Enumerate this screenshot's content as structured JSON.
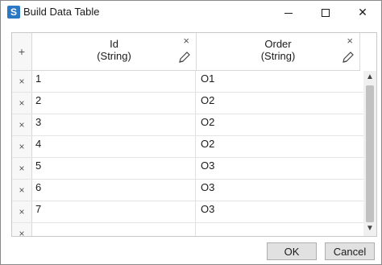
{
  "window": {
    "title": "Build Data Table",
    "app_icon_glyph": "S",
    "controls": {
      "minimize": "",
      "maximize": "",
      "close": "✕"
    }
  },
  "grid": {
    "add_glyph": "+",
    "columns": [
      {
        "name": "Id",
        "type": "(String)",
        "remove_glyph": "×"
      },
      {
        "name": "Order",
        "type": "(String)",
        "remove_glyph": "×"
      }
    ],
    "row_remove_glyph": "×",
    "rows": [
      {
        "id": "1",
        "order": "O1"
      },
      {
        "id": "2",
        "order": "O2"
      },
      {
        "id": "3",
        "order": "O2"
      },
      {
        "id": "4",
        "order": "O2"
      },
      {
        "id": "5",
        "order": "O3"
      },
      {
        "id": "6",
        "order": "O3"
      },
      {
        "id": "7",
        "order": "O3"
      },
      {
        "id": "",
        "order": ""
      }
    ],
    "scroll_up": "▲",
    "scroll_down": "▼"
  },
  "buttons": {
    "ok": "OK",
    "cancel": "Cancel"
  },
  "icons": {
    "app": "app-logo-icon",
    "add": "plus-icon",
    "remove": "close-icon",
    "edit": "pencil-icon"
  },
  "colors": {
    "app_icon": "#2b78c5"
  }
}
